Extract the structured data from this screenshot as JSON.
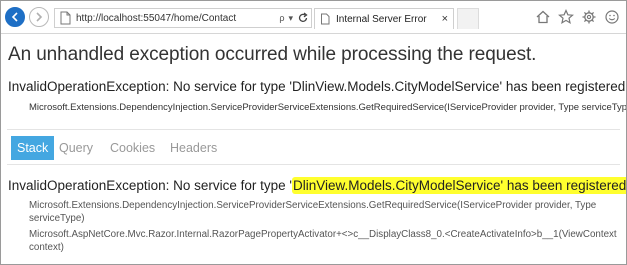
{
  "browser": {
    "url_host": "http://localhost",
    "url_rest": ":55047/home/Contact",
    "search_glyph": "ρ",
    "dropdown_glyph": "▾",
    "tab_title": "Internal Server Error",
    "tab_close": "×"
  },
  "page": {
    "title": "An unhandled exception occurred while processing the request.",
    "exception_message": "InvalidOperationException: No service for type 'DlinView.Models.CityModelService' has been registered.",
    "exception_source": "Microsoft.Extensions.DependencyInjection.ServiceProviderServiceExtensions.GetRequiredService(IServiceProvider provider, Type serviceType)"
  },
  "tabs": [
    {
      "label": "Stack",
      "active": true
    },
    {
      "label": "Query",
      "active": false
    },
    {
      "label": "Cookies",
      "active": false
    },
    {
      "label": "Headers",
      "active": false
    }
  ],
  "stack": {
    "exception_prefix": "InvalidOperationException: No service for type '",
    "exception_highlight": "DlinView.Models.CityModelService' has been registered.",
    "frames": [
      "Microsoft.Extensions.DependencyInjection.ServiceProviderServiceExtensions.GetRequiredService(IServiceProvider provider, Type serviceType)",
      "Microsoft.AspNetCore.Mvc.Razor.Internal.RazorPagePropertyActivator+<>c__DisplayClass8_0.<CreateActivateInfo>b__1(ViewContext context)"
    ]
  },
  "colors": {
    "active_tab": "#44a7e1",
    "highlight": "#ffff2e",
    "back_button": "#1e6fc5"
  }
}
